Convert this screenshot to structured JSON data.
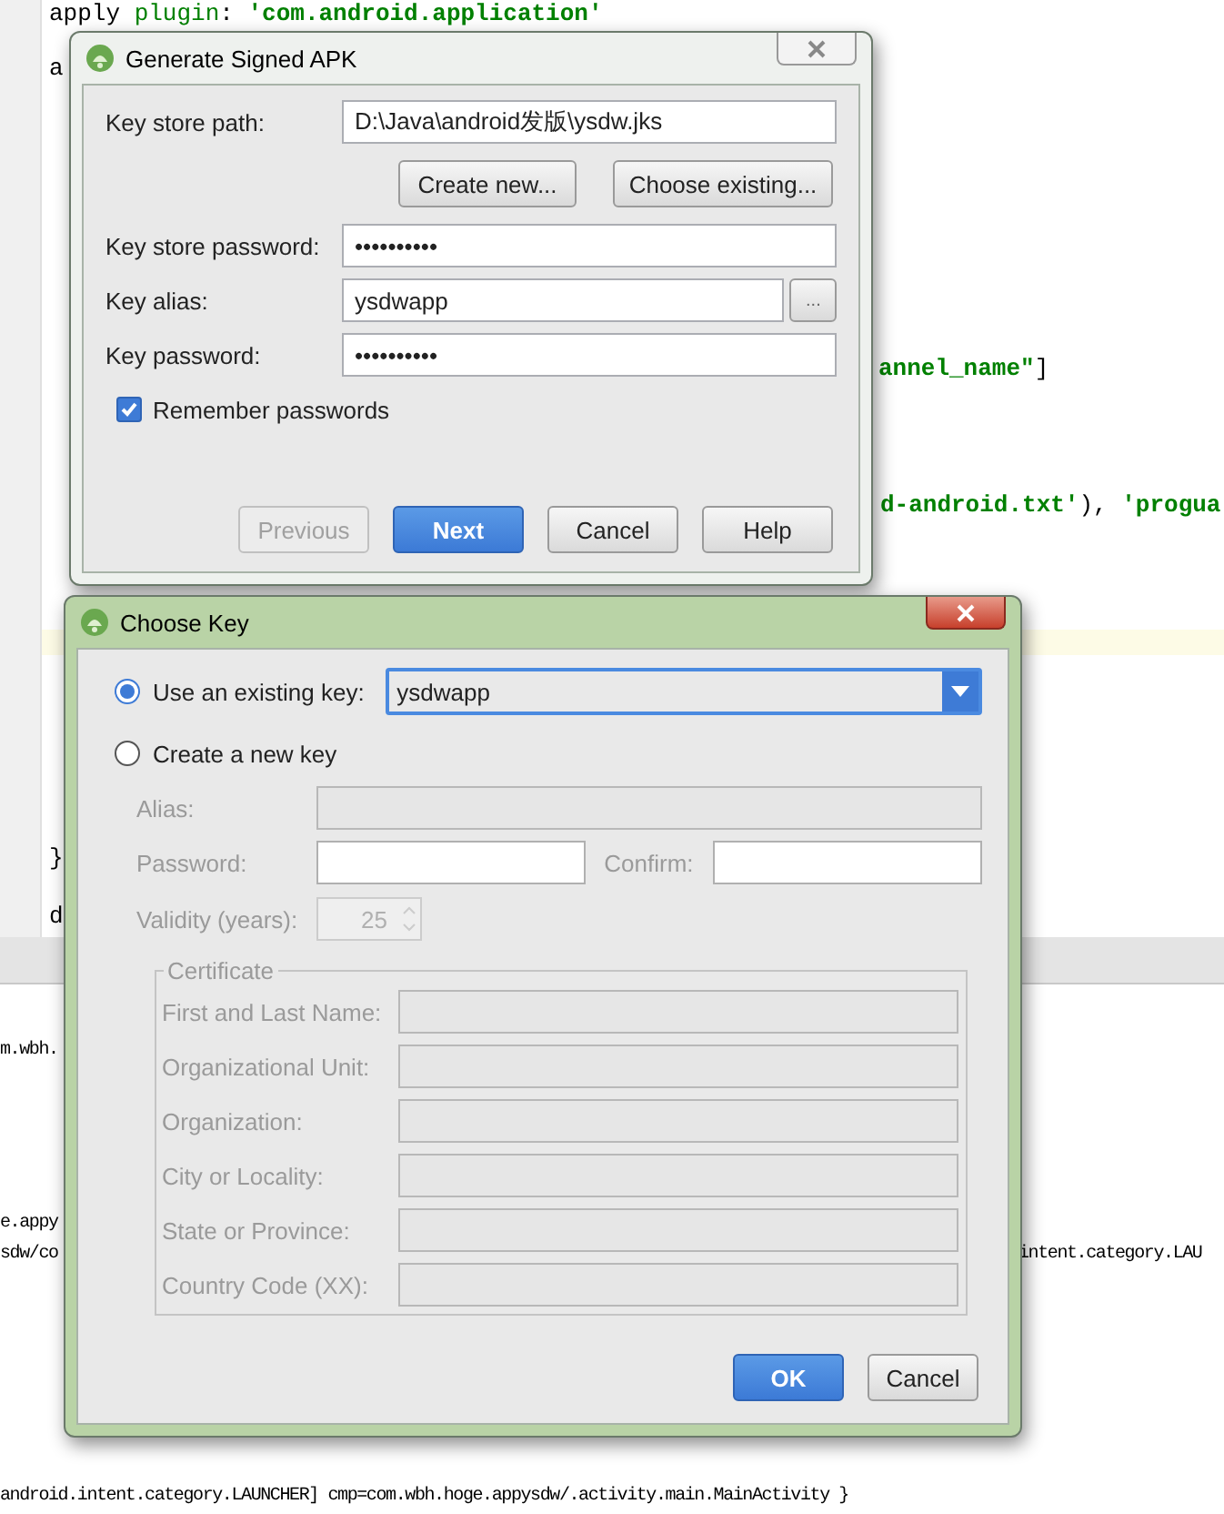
{
  "editor": {
    "code": [
      {
        "segments": [
          {
            "kind": "plain",
            "text": "apply "
          },
          {
            "kind": "keyword",
            "text": "plugin"
          },
          {
            "kind": "plain",
            "text": ": "
          },
          {
            "kind": "string",
            "text": "'com.android.application'"
          }
        ]
      },
      {
        "segments": [
          {
            "kind": "plain",
            "text": "a"
          }
        ]
      },
      {
        "segments": [
          {
            "kind": "string",
            "text": "annel_name\""
          },
          {
            "kind": "plain",
            "text": "]"
          }
        ]
      },
      {
        "segments": [
          {
            "kind": "string",
            "text": "d-android.txt'"
          },
          {
            "kind": "plain",
            "text": "), "
          },
          {
            "kind": "string",
            "text": "'progua"
          }
        ]
      },
      {
        "segments": [
          {
            "kind": "plain",
            "text": "}"
          }
        ]
      },
      {
        "segments": [
          {
            "kind": "plain",
            "text": "d"
          }
        ]
      }
    ]
  },
  "console": {
    "lines": [
      {
        "text": "m.wbh."
      },
      {
        "text": "e.appy"
      },
      {
        "text": "sdw/co"
      },
      {
        "text": "intent.category.LAU"
      },
      {
        "text": "android.intent.category.LAUNCHER] cmp=com.wbh.hoge.appysdw/.activity.main.MainActivity }"
      }
    ]
  },
  "signed_apk_dialog": {
    "title": "Generate Signed APK",
    "key_store_path": {
      "label": "Key store path:",
      "value": "D:\\Java\\android发版\\ysdw.jks"
    },
    "store_buttons": [
      "Create new...",
      "Choose existing..."
    ],
    "key_store_password": {
      "label": "Key store password:",
      "value": "••••••••••"
    },
    "key_alias": {
      "label": "Key alias:",
      "value": "ysdwapp",
      "browse": "..."
    },
    "key_password": {
      "label": "Key password:",
      "value": "••••••••••"
    },
    "remember": {
      "label": "Remember passwords",
      "checked": true
    },
    "buttons": [
      {
        "label": "Previous",
        "disabled": true,
        "primary": false
      },
      {
        "label": "Next",
        "disabled": false,
        "primary": true
      },
      {
        "label": "Cancel",
        "disabled": false,
        "primary": false
      },
      {
        "label": "Help",
        "disabled": false,
        "primary": false
      }
    ]
  },
  "choose_key_dialog": {
    "title": "Choose Key",
    "options": [
      {
        "label": "Use an existing key:",
        "selected": true
      },
      {
        "label": "Create a new key",
        "selected": false
      }
    ],
    "existing_key": {
      "value": "ysdwapp"
    },
    "new_key": {
      "disabled": true,
      "alias_label": "Alias:",
      "password_label": "Password:",
      "confirm_label": "Confirm:",
      "validity_label": "Validity (years):",
      "validity_value": "25",
      "certificate_title": "Certificate",
      "certificate_fields": [
        {
          "label": "First and Last Name:"
        },
        {
          "label": "Organizational Unit:"
        },
        {
          "label": "Organization:"
        },
        {
          "label": "City or Locality:"
        },
        {
          "label": "State or Province:"
        },
        {
          "label": "Country Code (XX):"
        }
      ]
    },
    "buttons": [
      {
        "label": "OK",
        "primary": true
      },
      {
        "label": "Cancel",
        "primary": false
      }
    ]
  }
}
